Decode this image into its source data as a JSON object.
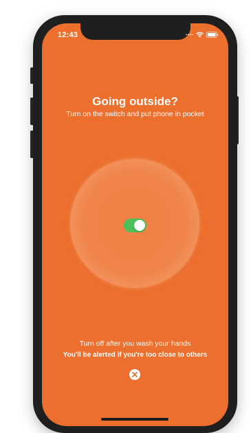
{
  "status_bar": {
    "time": "12:43",
    "signal_icon": "signal-dots-icon",
    "wifi_icon": "wifi-icon",
    "battery_icon": "battery-icon"
  },
  "prompt": {
    "title": "Going outside?",
    "subtitle": "Turn on the switch and put phone in pocket"
  },
  "toggle": {
    "state": "on",
    "on_color": "#4cbf56"
  },
  "footer": {
    "hint": "Turn off after you wash your hands",
    "alert": "You'll be alerted if you're too close to others",
    "close_icon": "close-icon"
  },
  "colors": {
    "background": "#ec6f2d",
    "text": "#ffffff",
    "phone_frame": "#1f1f1f"
  }
}
